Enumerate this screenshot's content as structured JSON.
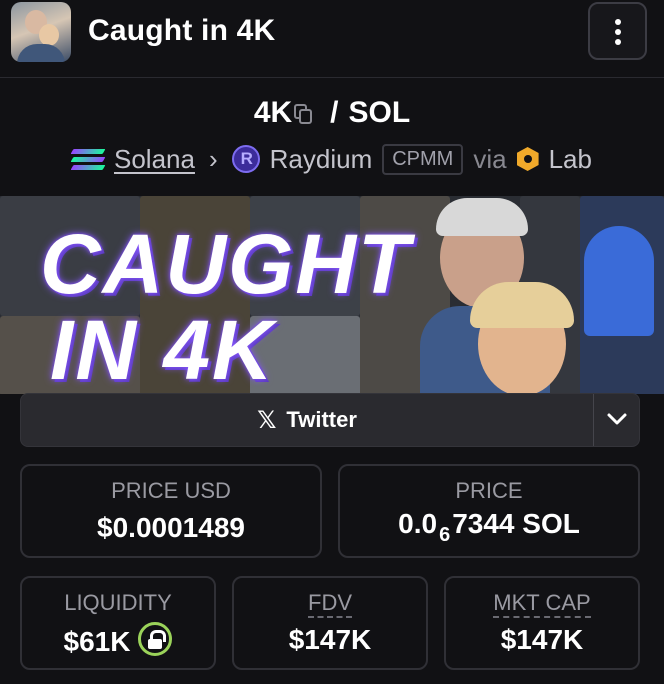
{
  "header": {
    "title": "Caught in 4K",
    "avatar_icon": "token-avatar",
    "menu_icon": "more-vertical-icon"
  },
  "pair": {
    "base": "4K",
    "separator": "/",
    "quote": "SOL",
    "copy_icon": "copy-icon"
  },
  "chain": {
    "network": "Solana",
    "dex": "Raydium",
    "pool_type": "CPMM",
    "via": "via",
    "launchpad": "Lab",
    "chevron": "›"
  },
  "banner": {
    "line1": "CAUGHT",
    "line2": "IN 4K"
  },
  "social": {
    "label": "Twitter",
    "icon": "𝕏"
  },
  "stats": {
    "price_usd": {
      "label": "PRICE USD",
      "value": "$0.0001489"
    },
    "price": {
      "label": "PRICE",
      "value_prefix": "0.0",
      "value_subscript": "6",
      "value_suffix": "7344 SOL"
    },
    "liquidity": {
      "label": "LIQUIDITY",
      "value": "$61K"
    },
    "fdv": {
      "label": "FDV",
      "value": "$147K"
    },
    "mkt_cap": {
      "label": "MKT CAP",
      "value": "$147K"
    }
  },
  "colors": {
    "background": "#111114",
    "card_border": "#303036",
    "muted_text": "#9a9aa2",
    "lock_ring": "#9bd35a",
    "accent_glow": "#8a5cff"
  }
}
